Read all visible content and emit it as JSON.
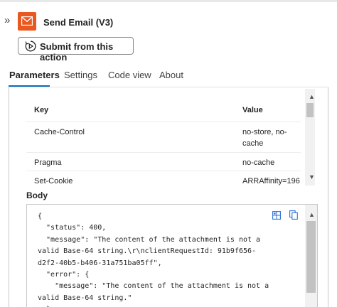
{
  "header": {
    "title": "Send Email (V3)",
    "collapse_glyph": "»",
    "icon": "outlook-mail-icon",
    "brand_color": "#e8581f"
  },
  "toolbar": {
    "submit_label": "Submit from this action"
  },
  "tabs": [
    {
      "label": "Parameters",
      "active": true
    },
    {
      "label": "Settings",
      "active": false
    },
    {
      "label": "Code view",
      "active": false
    },
    {
      "label": "About",
      "active": false
    }
  ],
  "headers_table": {
    "columns": [
      "Key",
      "Value"
    ],
    "rows": [
      {
        "key": "Cache-Control",
        "value": "no-store, no-cache"
      },
      {
        "key": "Pragma",
        "value": "no-cache"
      },
      {
        "key": "Set-Cookie",
        "value": "ARRAffinity=196"
      }
    ]
  },
  "body": {
    "label": "Body",
    "lines": [
      "{",
      "  \"status\": 400,",
      "  \"message\": \"The content of the attachment is not a",
      "valid Base-64 string.\\r\\nclientRequestId: 91b9f656-",
      "d2f2-40b5-b406-31a751ba05ff\",",
      "  \"error\": {",
      "    \"message\": \"The content of the attachment is not a",
      "valid Base-64 string.\"",
      "  }"
    ]
  },
  "colors": {
    "accent": "#0f6cbd",
    "icon_blue": "#2b6fd6"
  }
}
